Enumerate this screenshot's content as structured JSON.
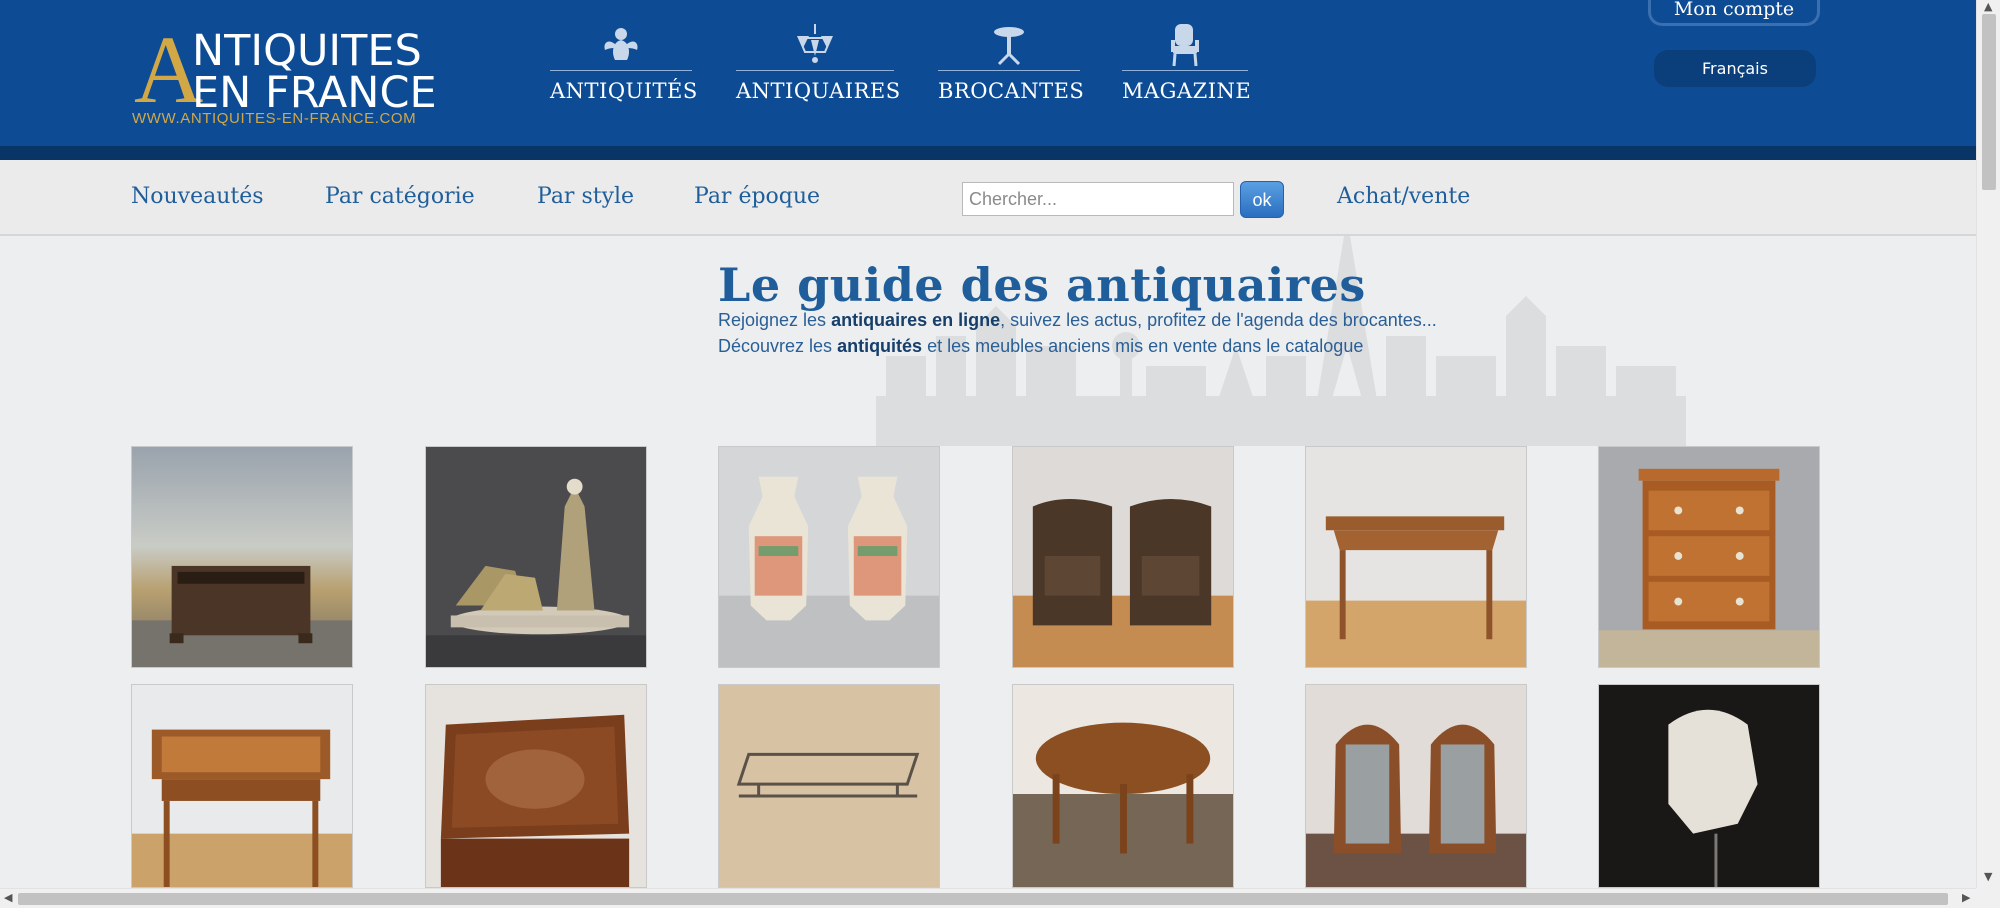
{
  "site": {
    "logo_initial": "A",
    "logo_line1": "NTIQUITES",
    "logo_line2": "EN FRANCE",
    "logo_url": "WWW.ANTIQUITES-EN-FRANCE.COM"
  },
  "main_nav": [
    {
      "label": "ANTIQUITÉS",
      "icon": "cherub-icon"
    },
    {
      "label": "ANTIQUAIRES",
      "icon": "chandelier-icon"
    },
    {
      "label": "BROCANTES",
      "icon": "pedestal-table-icon"
    },
    {
      "label": "MAGAZINE",
      "icon": "armchair-icon"
    }
  ],
  "account": {
    "label": "Mon compte"
  },
  "language": {
    "label": "Français"
  },
  "sub_nav": {
    "items": [
      "Nouveautés",
      "Par catégorie",
      "Par style",
      "Par époque"
    ],
    "search_placeholder": "Chercher...",
    "search_button": "ok",
    "achat_vente": "Achat/vente"
  },
  "hero": {
    "title": "Le guide des antiquaires",
    "line1_pre": "Rejoignez les ",
    "line1_bold": "antiquaires en ligne",
    "line1_post": ", suivez les actus, profitez de l'agenda des brocantes...",
    "line2_pre": "Découvrez les ",
    "line2_bold": "antiquités",
    "line2_post": " et les meubles anciens mis en vente dans le catalogue"
  },
  "products": [
    {
      "subject": "jardiniere-box"
    },
    {
      "subject": "art-deco-sculpture"
    },
    {
      "subject": "canton-vases"
    },
    {
      "subject": "leather-club-chairs"
    },
    {
      "subject": "louis-xv-writing-table"
    },
    {
      "subject": "chest-of-drawers"
    },
    {
      "subject": "marquetry-side-table"
    },
    {
      "subject": "carved-wooden-box"
    },
    {
      "subject": "metal-luggage-rack"
    },
    {
      "subject": "oval-coffee-table"
    },
    {
      "subject": "art-deco-armchairs"
    },
    {
      "subject": "plaster-bust"
    }
  ],
  "colors": {
    "header_blue": "#0d4c95",
    "gold": "#d2a847",
    "link_blue": "#1f5e9a"
  }
}
